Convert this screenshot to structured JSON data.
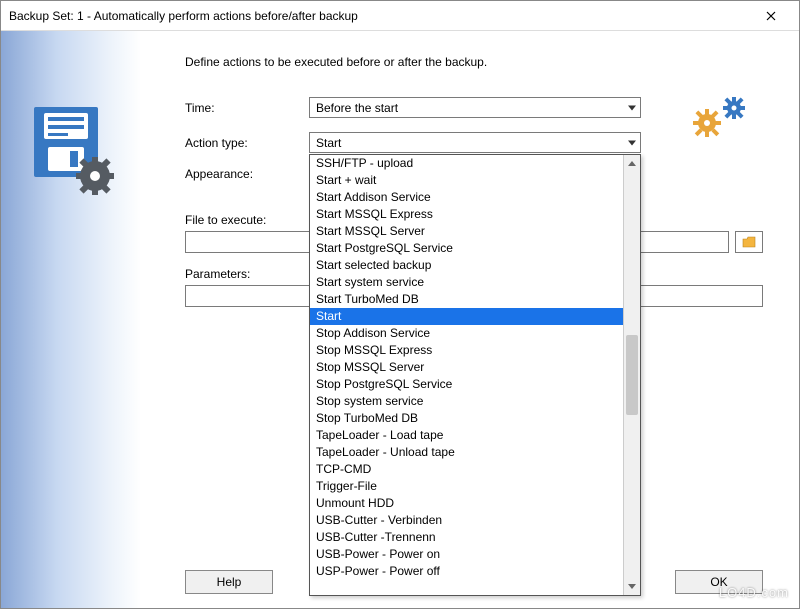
{
  "window": {
    "title": "Backup Set: 1 - Automatically perform actions before/after backup"
  },
  "instruction": "Define actions to be executed before or after the backup.",
  "labels": {
    "time": "Time:",
    "action_type": "Action type:",
    "appearance": "Appearance:",
    "file": "File to execute:",
    "params": "Parameters:"
  },
  "fields": {
    "time_value": "Before the start",
    "action_type_value": "Start",
    "help": "Help",
    "ok": "OK"
  },
  "dropdown": {
    "selected_index": 9,
    "items": [
      "SSH/FTP - upload",
      "Start + wait",
      "Start Addison Service",
      "Start MSSQL Express",
      "Start MSSQL Server",
      "Start PostgreSQL Service",
      "Start selected backup",
      "Start system service",
      "Start TurboMed DB",
      "Start",
      "Stop Addison Service",
      "Stop MSSQL Express",
      "Stop MSSQL Server",
      "Stop PostgreSQL Service",
      "Stop system service",
      "Stop TurboMed DB",
      "TapeLoader - Load tape",
      "TapeLoader - Unload tape",
      "TCP-CMD",
      "Trigger-File",
      "Unmount HDD",
      "USB-Cutter - Verbinden",
      "USB-Cutter -Trennenn",
      "USB-Power - Power on",
      "USP-Power - Power off"
    ]
  },
  "watermark": "LO4D.com"
}
